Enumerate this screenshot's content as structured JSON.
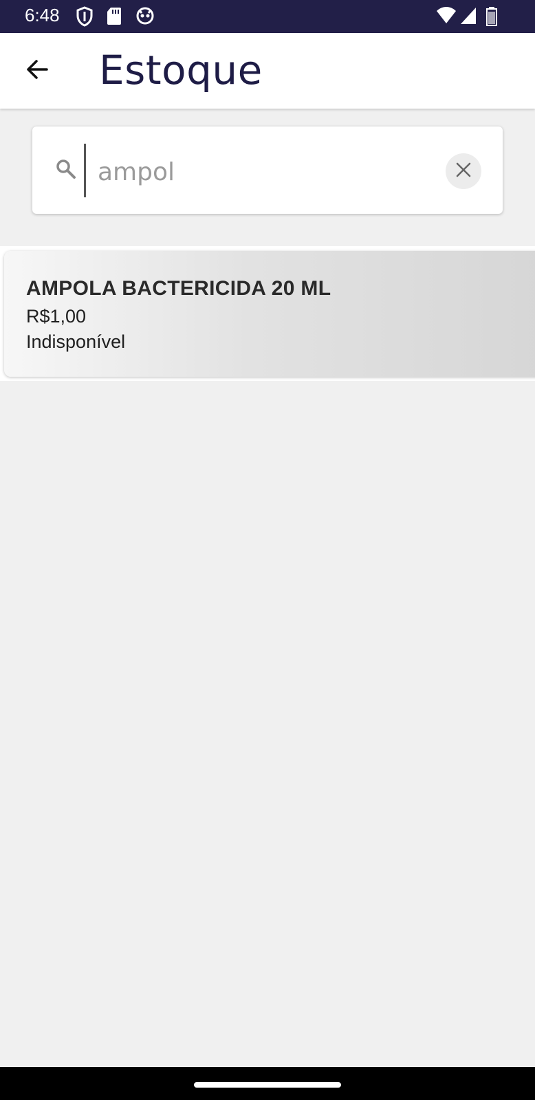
{
  "status_bar": {
    "time": "6:48",
    "icons": [
      "shield-icon",
      "sd-card-icon",
      "cat-face-icon",
      "wifi-icon",
      "signal-icon",
      "battery-icon"
    ]
  },
  "app_bar": {
    "back_icon": "arrow-left-icon",
    "title": "Estoque",
    "title_color": "#1e1c46"
  },
  "search": {
    "value": "ampol",
    "icon": "search-icon",
    "clear_icon": "close-icon"
  },
  "products": [
    {
      "name": "AMPOLA BACTERICIDA 20 ML",
      "price": "R$1,00",
      "availability": "Indisponível"
    }
  ],
  "colors": {
    "status_bar": "#221f48",
    "background": "#f0f0f0"
  }
}
